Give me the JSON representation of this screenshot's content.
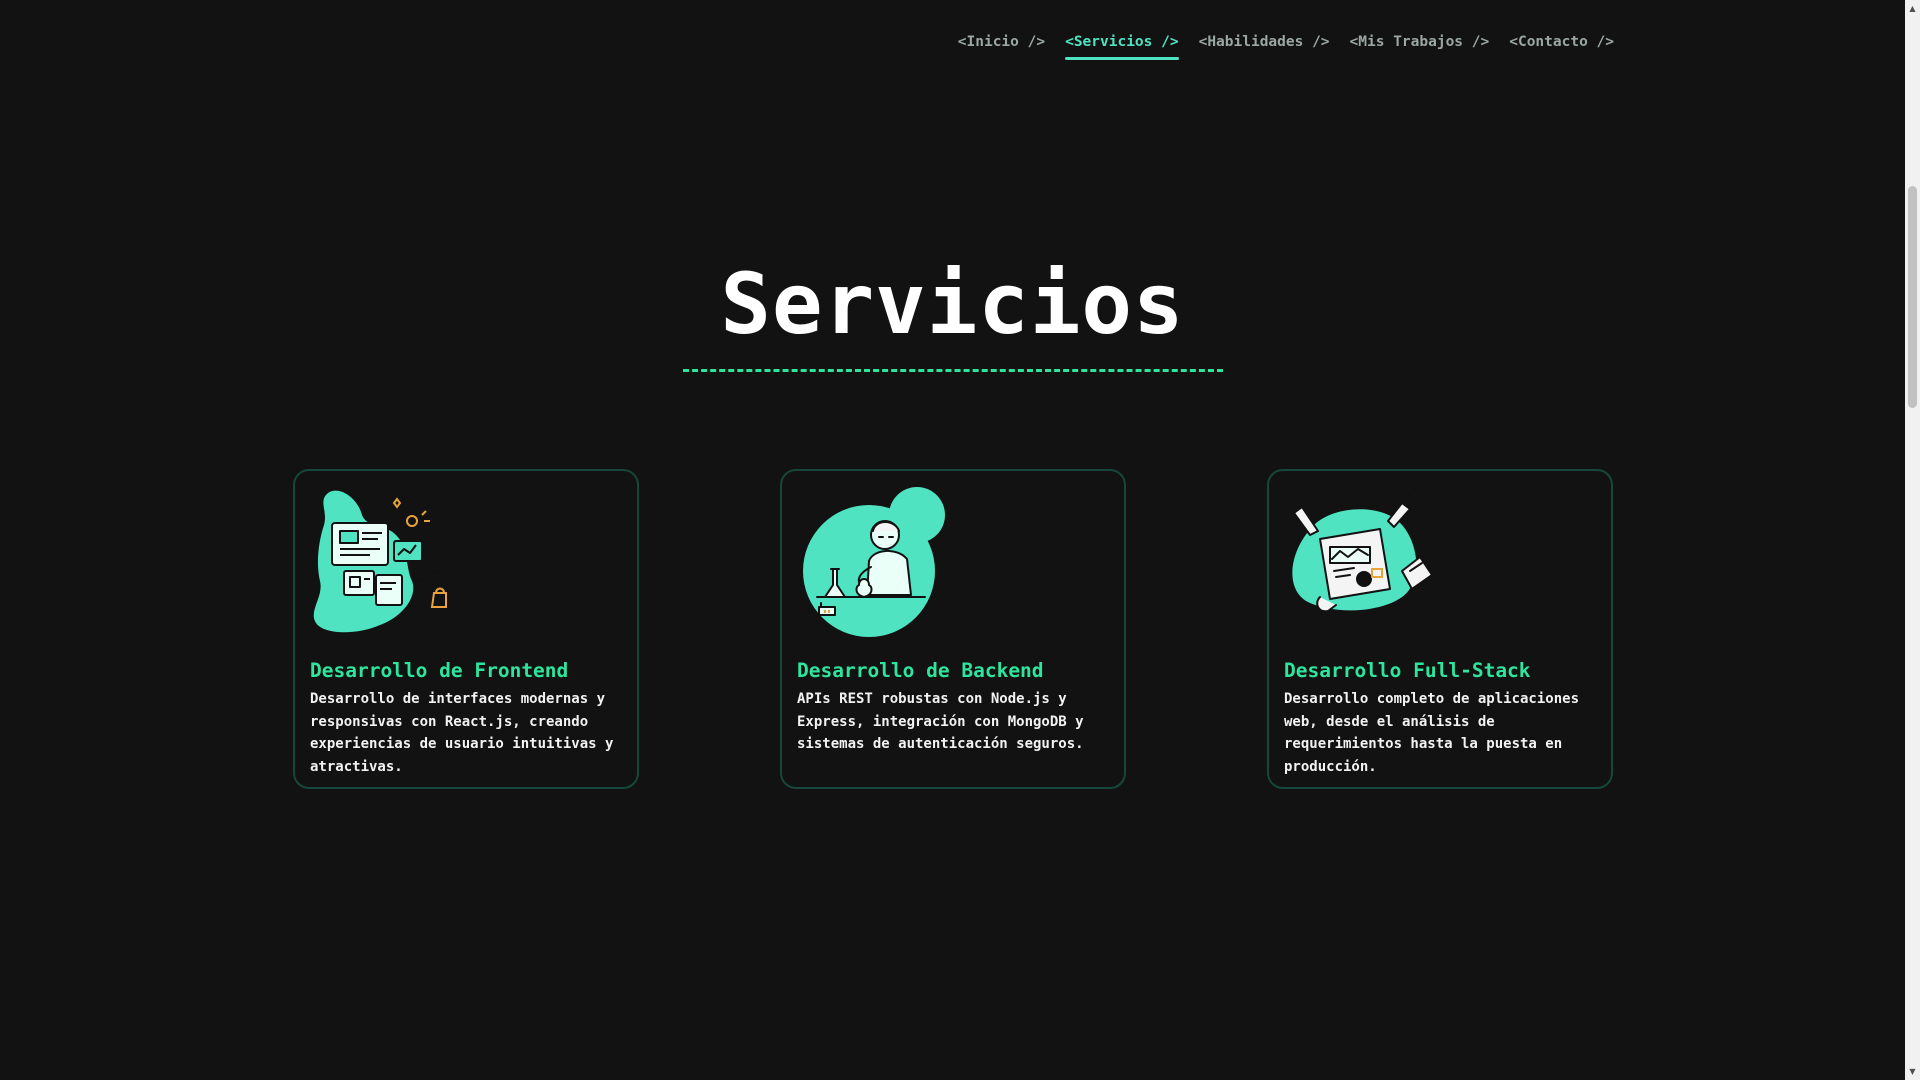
{
  "nav": {
    "items": [
      {
        "label": "<Inicio />",
        "active": false
      },
      {
        "label": "<Servicios />",
        "active": true
      },
      {
        "label": "<Habilidades />",
        "active": false
      },
      {
        "label": "<Mis Trabajos />",
        "active": false
      },
      {
        "label": "<Contacto />",
        "active": false
      }
    ]
  },
  "section": {
    "title": "Servicios"
  },
  "cards": [
    {
      "title": "Desarrollo de Frontend",
      "description": "Desarrollo de interfaces modernas y responsivas con React.js, creando experiencias de usuario intuitivas y atractivas.",
      "icon": "frontend-illustration"
    },
    {
      "title": "Desarrollo de Backend",
      "description": "APIs REST robustas con Node.js y Express, integración con MongoDB y sistemas de autenticación seguros.",
      "icon": "backend-illustration"
    },
    {
      "title": "Desarrollo Full-Stack",
      "description": "Desarrollo completo de aplicaciones web, desde el análisis de requerimientos hasta la puesta en producción.",
      "icon": "fullstack-illustration"
    }
  ],
  "colors": {
    "background": "#121212",
    "accent": "#2ee59d",
    "illustration": "#4fe3c1",
    "card_border": "#17473a",
    "nav_text": "#9aa7a3"
  }
}
